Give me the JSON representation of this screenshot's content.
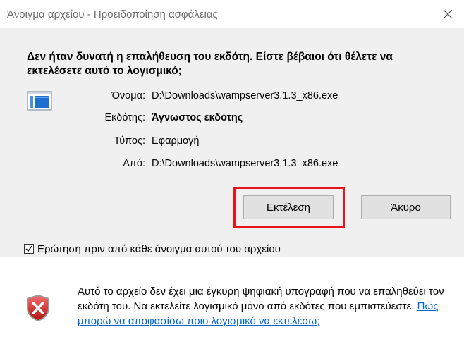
{
  "window": {
    "title": "Άνοιγμα αρχείου - Προειδοποίηση ασφάλειας"
  },
  "warning": {
    "headline": "Δεν ήταν δυνατή η επαλήθευση του εκδότη. Είστε βέβαιοι ότι θέλετε να εκτελέσετε αυτό το λογισμικό;"
  },
  "file_info": {
    "name_label": "Όνομα:",
    "name_value": "D:\\Downloads\\wampserver3.1.3_x86.exe",
    "publisher_label": "Εκδότης:",
    "publisher_value": "Άγνωστος εκδότης",
    "type_label": "Τύπος:",
    "type_value": "Εφαρμογή",
    "from_label": "Από:",
    "from_value": "D:\\Downloads\\wampserver3.1.3_x86.exe"
  },
  "buttons": {
    "run_label": "Εκτέλεση",
    "cancel_label": "Άκυρο"
  },
  "checkbox": {
    "label": "Ερώτηση πριν από κάθε άνοιγμα αυτού του αρχείου",
    "checked": true
  },
  "footer": {
    "text": "Αυτό το αρχείο δεν έχει μια έγκυρη ψηφιακή υπογραφή που να επαληθεύει τον εκδότη του. Να εκτελείτε λογισμικό μόνο από εκδότες που εμπιστεύεστε.",
    "link_text": "Πώς μπορώ να αποφασίσω ποιο λογισμικό να εκτελέσω;"
  },
  "colors": {
    "highlight": "#e8131b",
    "link": "#0066cc",
    "main_bg": "#f0f0f0"
  },
  "icons": {
    "close": "close-icon",
    "file": "application-file-icon",
    "shield": "security-shield-icon",
    "check": "checkmark-icon"
  }
}
